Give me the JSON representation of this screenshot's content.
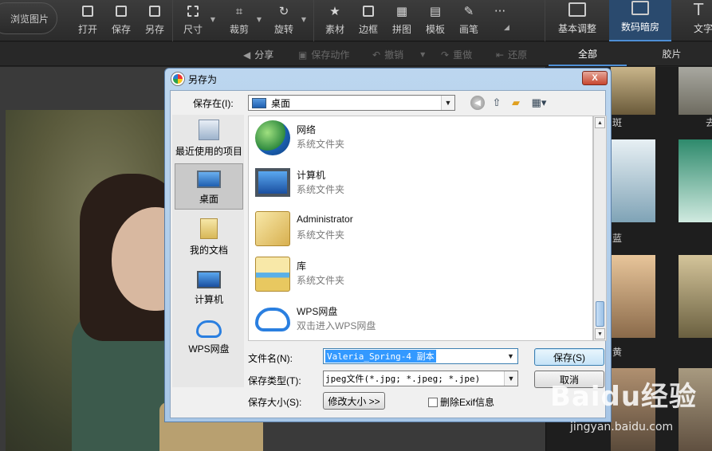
{
  "app": {
    "browse_label": "浏览图片",
    "toolbar": [
      {
        "label": "打开",
        "icon": "open-icon"
      },
      {
        "label": "保存",
        "icon": "save-icon"
      },
      {
        "label": "另存",
        "icon": "save-as-icon"
      },
      {
        "label": "尺寸",
        "icon": "resize-icon"
      },
      {
        "label": "裁剪",
        "icon": "crop-icon"
      },
      {
        "label": "旋转",
        "icon": "rotate-icon"
      },
      {
        "label": "素材",
        "icon": "material-icon"
      },
      {
        "label": "边框",
        "icon": "border-icon"
      },
      {
        "label": "拼图",
        "icon": "collage-icon"
      },
      {
        "label": "模板",
        "icon": "template-icon"
      },
      {
        "label": "画笔",
        "icon": "brush-icon"
      }
    ],
    "more_label": "···",
    "mode_tabs": [
      {
        "label": "基本调整",
        "active": false
      },
      {
        "label": "数码暗房",
        "active": true
      },
      {
        "label": "文字",
        "active": false
      }
    ],
    "subbar": {
      "share": "分享",
      "save_action": "保存动作",
      "undo": "撤销",
      "redo": "重做",
      "restore": "还原"
    },
    "filter_tabs": [
      "全部",
      "胶片"
    ],
    "filter_labels": [
      "斑",
      "去",
      "蓝",
      "黄"
    ]
  },
  "dialog": {
    "title": "另存为",
    "close_label": "X",
    "save_in_label": "保存在(I):",
    "save_in_value": "桌面",
    "places": [
      {
        "label": "最近使用的项目",
        "icon": "recent-items-icon"
      },
      {
        "label": "桌面",
        "icon": "desktop-icon",
        "active": true
      },
      {
        "label": "我的文档",
        "icon": "documents-icon"
      },
      {
        "label": "计算机",
        "icon": "computer-icon"
      },
      {
        "label": "WPS网盘",
        "icon": "wps-cloud-icon"
      }
    ],
    "items": [
      {
        "name": "网络",
        "type": "系统文件夹",
        "icon": "network-icon"
      },
      {
        "name": "计算机",
        "type": "系统文件夹",
        "icon": "computer-icon"
      },
      {
        "name": "Administrator",
        "type": "系统文件夹",
        "icon": "user-folder-icon"
      },
      {
        "name": "库",
        "type": "系统文件夹",
        "icon": "library-icon"
      },
      {
        "name": "WPS网盘",
        "type": "双击进入WPS网盘",
        "icon": "wps-cloud-icon"
      }
    ],
    "filename_label": "文件名(N):",
    "filename_value": "Valeria_Spring-4 副本",
    "filetype_label": "保存类型(T):",
    "filetype_value": "jpeg文件(*.jpg; *.jpeg; *.jpe)",
    "filesize_label": "保存大小(S):",
    "resize_button": "修改大小 >>",
    "exif_label": "删除Exif信息",
    "exif_checked": false,
    "save_button": "保存(S)",
    "cancel_button": "取消"
  },
  "watermark": {
    "brand": "Baidu经验",
    "url": "jingyan.baidu.com"
  }
}
